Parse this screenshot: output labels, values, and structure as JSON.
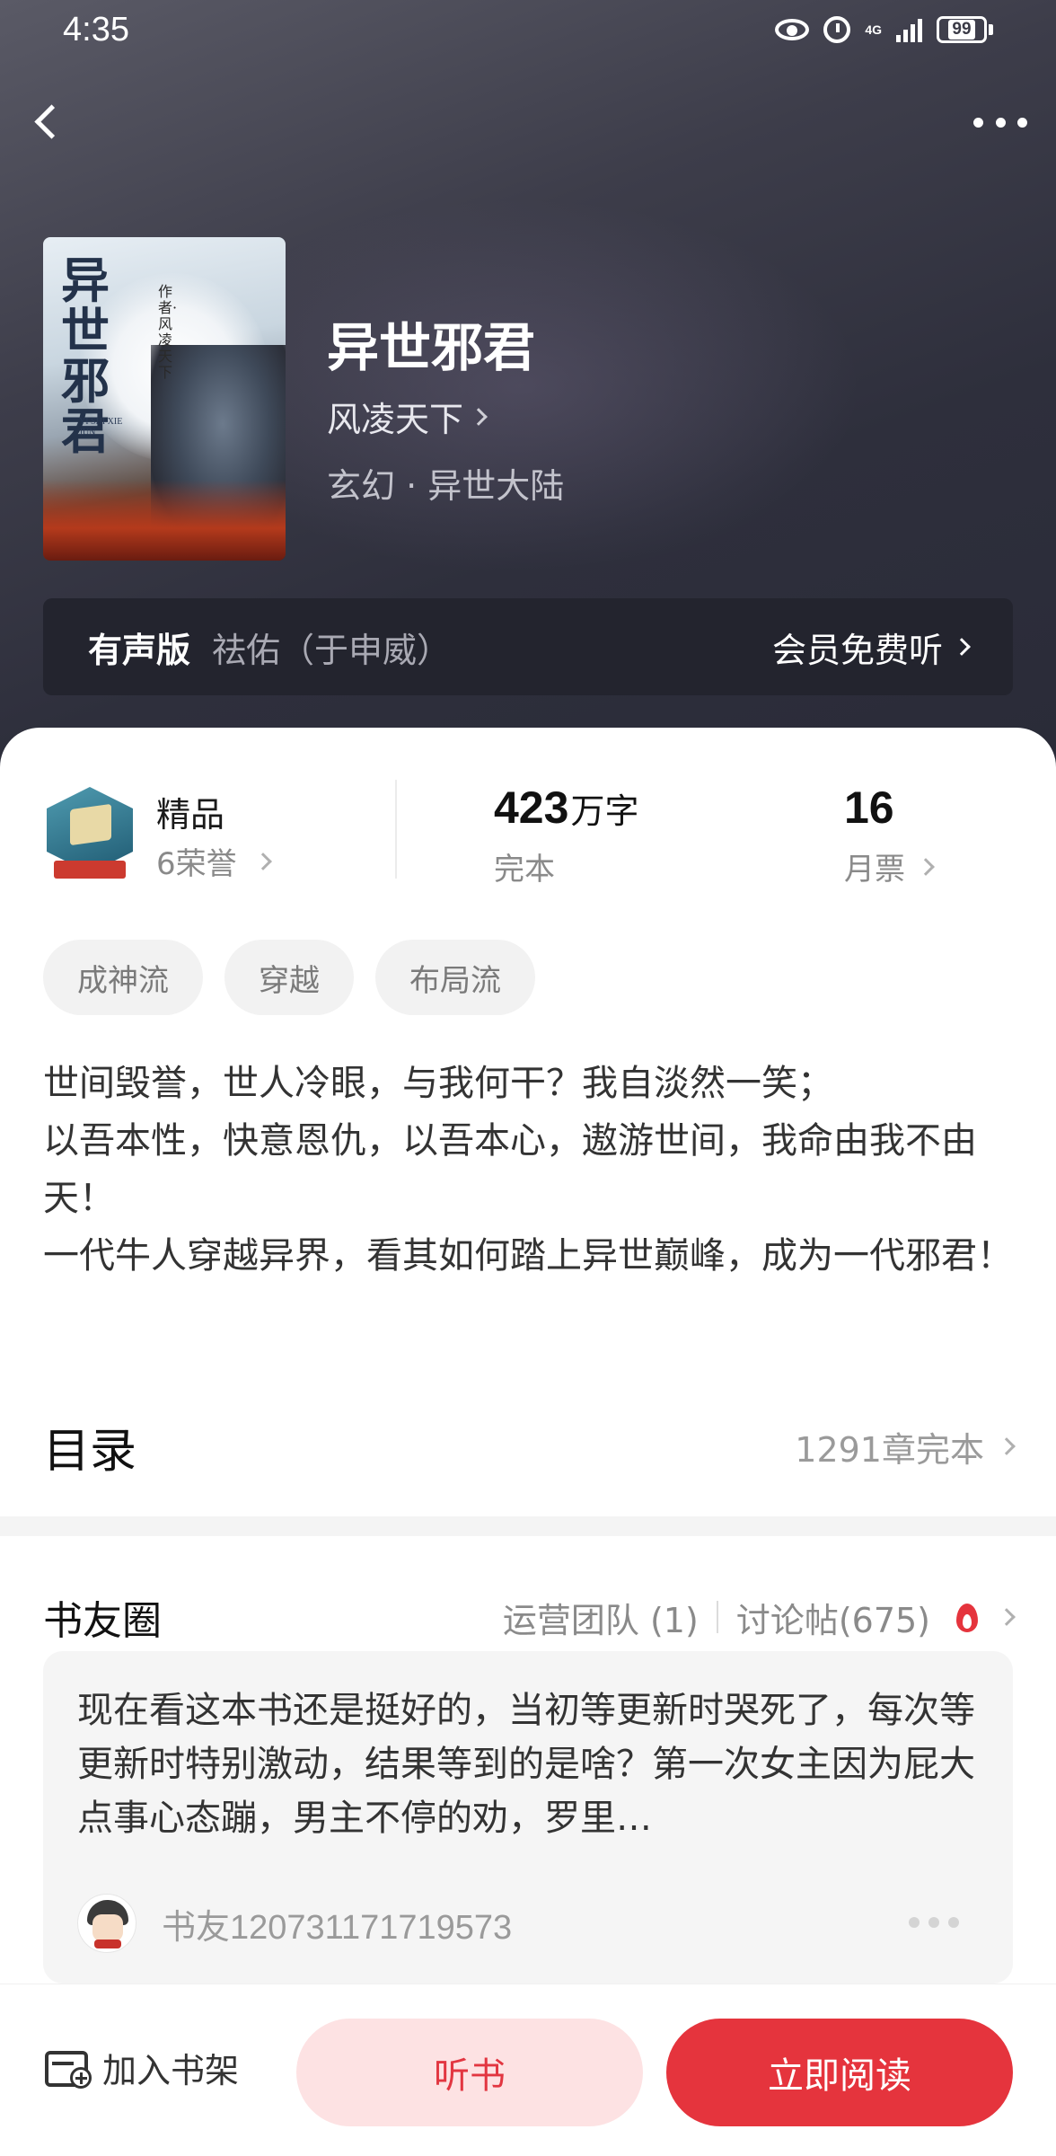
{
  "status_bar": {
    "time": "4:35",
    "network": "4G",
    "battery": "99"
  },
  "book": {
    "title": "异世邪君",
    "author": "风凌天下",
    "genre": "玄幻 · 异世大陆",
    "cover": {
      "title": "异世邪君",
      "author_line": "作者·风凌天下",
      "pinyin": "YI SHI XIE JUN"
    }
  },
  "audio": {
    "label": "有声版",
    "narrator": "祛佑（于申威）",
    "action": "会员免费听"
  },
  "stats": {
    "quality": "精品",
    "honors": "6荣誉",
    "words_number": "423",
    "words_unit": "万字",
    "status": "完本",
    "monthly_tickets": "16",
    "monthly_tickets_label": "月票"
  },
  "tags": [
    "成神流",
    "穿越",
    "布局流"
  ],
  "intro": [
    "世间毁誉，世人冷眼，与我何干？我自淡然一笑；",
    "以吾本性，快意恩仇，以吾本心，遨游世间，我命由我不由天！",
    "一代牛人穿越异界，看其如何踏上异世巅峰，成为一代邪君！"
  ],
  "toc": {
    "title": "目录",
    "count": "1291章完本"
  },
  "circle": {
    "title": "书友圈",
    "ops_team": "运营团队 (1)",
    "discussions": "讨论帖(675)",
    "post": {
      "text": "现在看这本书还是挺好的，当初等更新时哭死了，每次等更新时特别激动，结果等到的是啥？第一次女主因为屁大点事心态蹦，男主不停的劝，罗里…",
      "username": "书友120731171719573"
    }
  },
  "bottom_bar": {
    "shelf": "加入书架",
    "listen": "听书",
    "read": "立即阅读"
  },
  "colors": {
    "accent": "#e5343d",
    "accent_light": "#fde2e3",
    "header_bg": "#2e2f3c",
    "audio_bar_bg": "#23242e"
  }
}
